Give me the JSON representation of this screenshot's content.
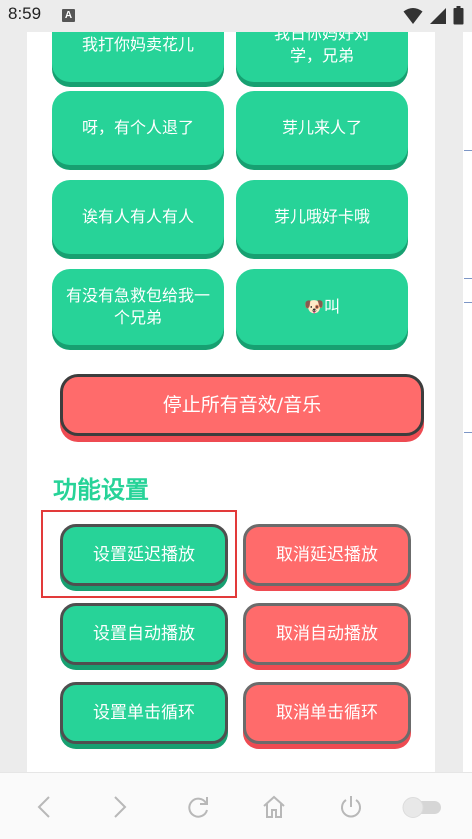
{
  "status_bar": {
    "time": "8:59",
    "app_icon_letter": "A",
    "icons": [
      "wifi-icon",
      "cellular-signal-icon",
      "battery-icon"
    ]
  },
  "sound_buttons": [
    {
      "label": "我打你妈卖花儿"
    },
    {
      "label": "我日你妈好对学，兄弟"
    },
    {
      "label": "呀，有个人退了"
    },
    {
      "label": "芽儿来人了"
    },
    {
      "label": "诶有人有人有人"
    },
    {
      "label": "芽儿哦好卡哦"
    },
    {
      "label": "有没有急救包给我一个兄弟"
    },
    {
      "label": "叫",
      "emoji": "🐶"
    }
  ],
  "stop_button": {
    "label": "停止所有音效/音乐"
  },
  "settings": {
    "title": "功能设置",
    "set_delay_label": "设置延迟播放",
    "cancel_delay_label": "取消延迟播放",
    "set_auto_label": "设置自动播放",
    "cancel_auto_label": "取消自动播放",
    "set_single_loop_label": "设置单击循环",
    "cancel_single_loop_label": "取消单击循环"
  },
  "bottom_nav": {
    "icons": [
      "back-arrow-icon",
      "forward-arrow-icon",
      "refresh-icon",
      "home-icon",
      "power-icon",
      "toggle-switch"
    ]
  },
  "colors": {
    "green": "#27d398",
    "red": "#ff6b6b",
    "highlight": "#e23a3a"
  }
}
